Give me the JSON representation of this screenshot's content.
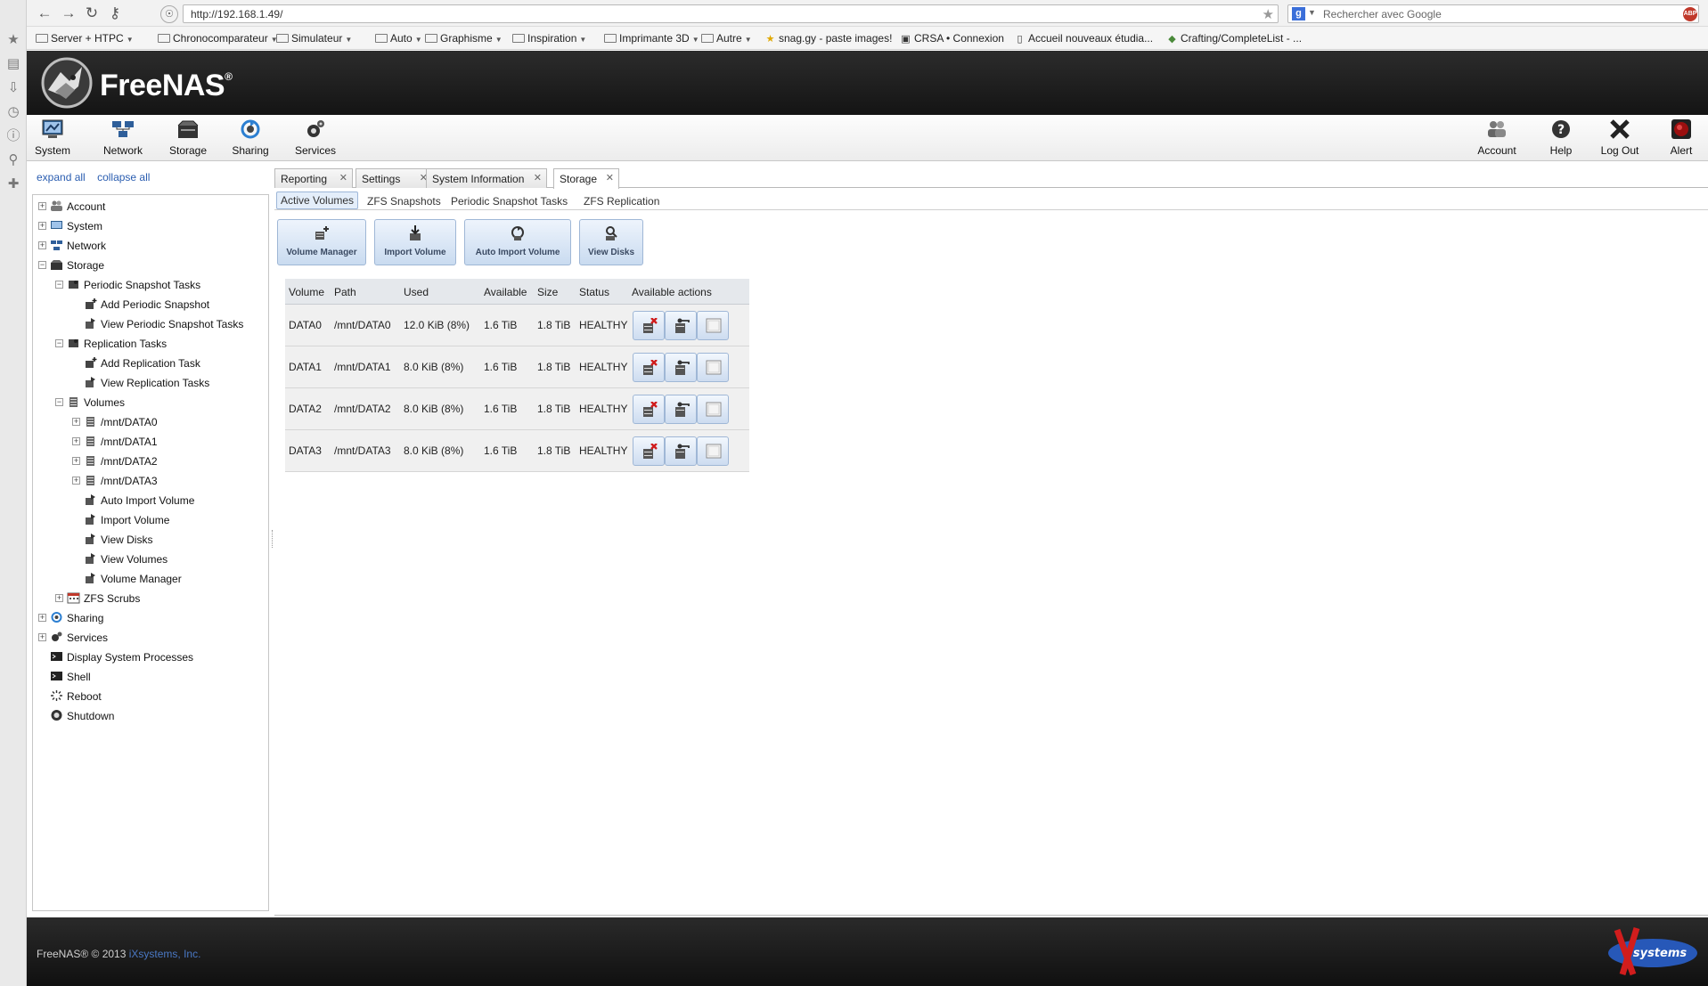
{
  "browser": {
    "url": "http://192.168.1.49/",
    "search_placeholder": "Rechercher avec Google",
    "abp_label": "ABP",
    "bookmarks": [
      {
        "label": "Server + HTPC",
        "folder": true,
        "caret": true
      },
      {
        "label": "Chronocomparateur",
        "folder": true,
        "caret": true
      },
      {
        "label": "Simulateur",
        "folder": true,
        "caret": true
      },
      {
        "label": "Auto",
        "folder": true,
        "caret": true
      },
      {
        "label": "Graphisme",
        "folder": true,
        "caret": true
      },
      {
        "label": "Inspiration",
        "folder": true,
        "caret": true
      },
      {
        "label": "Imprimante 3D",
        "folder": true,
        "caret": true
      },
      {
        "label": "Autre",
        "folder": true,
        "caret": true
      },
      {
        "label": "snag.gy - paste images!",
        "icon": "star-icon"
      },
      {
        "label": "CRSA • Connexion",
        "icon": "crsa-icon"
      },
      {
        "label": "Accueil nouveaux étudia...",
        "icon": "doc-icon"
      },
      {
        "label": "Crafting/CompleteList - ...",
        "icon": "cube-icon"
      }
    ]
  },
  "app": {
    "logo_text": "FreeNAS",
    "logo_mark": "®",
    "nav_left": [
      {
        "label": "System",
        "icon": "system-icon"
      },
      {
        "label": "Network",
        "icon": "network-icon"
      },
      {
        "label": "Storage",
        "icon": "storage-icon"
      },
      {
        "label": "Sharing",
        "icon": "sharing-icon"
      },
      {
        "label": "Services",
        "icon": "services-icon"
      }
    ],
    "nav_right": [
      {
        "label": "Account",
        "icon": "account-icon"
      },
      {
        "label": "Help",
        "icon": "help-icon"
      },
      {
        "label": "Log Out",
        "icon": "logout-icon"
      },
      {
        "label": "Alert",
        "icon": "alert-icon"
      }
    ]
  },
  "tree": {
    "expand_all": "expand all",
    "collapse_all": "collapse all",
    "items": [
      {
        "label": "Account",
        "level": 0,
        "expander": "+"
      },
      {
        "label": "System",
        "level": 0,
        "expander": "+"
      },
      {
        "label": "Network",
        "level": 0,
        "expander": "+"
      },
      {
        "label": "Storage",
        "level": 0,
        "expander": "−"
      },
      {
        "label": "Periodic Snapshot Tasks",
        "level": 1,
        "expander": "−"
      },
      {
        "label": "Add Periodic Snapshot",
        "level": 2,
        "expander": ""
      },
      {
        "label": "View Periodic Snapshot Tasks",
        "level": 2,
        "expander": ""
      },
      {
        "label": "Replication Tasks",
        "level": 1,
        "expander": "−"
      },
      {
        "label": "Add Replication Task",
        "level": 2,
        "expander": ""
      },
      {
        "label": "View Replication Tasks",
        "level": 2,
        "expander": ""
      },
      {
        "label": "Volumes",
        "level": 1,
        "expander": "−"
      },
      {
        "label": "/mnt/DATA0",
        "level": 2,
        "expander": "+"
      },
      {
        "label": "/mnt/DATA1",
        "level": 2,
        "expander": "+"
      },
      {
        "label": "/mnt/DATA2",
        "level": 2,
        "expander": "+"
      },
      {
        "label": "/mnt/DATA3",
        "level": 2,
        "expander": "+"
      },
      {
        "label": "Auto Import Volume",
        "level": 2,
        "expander": ""
      },
      {
        "label": "Import Volume",
        "level": 2,
        "expander": ""
      },
      {
        "label": "View Disks",
        "level": 2,
        "expander": ""
      },
      {
        "label": "View Volumes",
        "level": 2,
        "expander": ""
      },
      {
        "label": "Volume Manager",
        "level": 2,
        "expander": ""
      },
      {
        "label": "ZFS Scrubs",
        "level": 1,
        "expander": "+"
      },
      {
        "label": "Sharing",
        "level": 0,
        "expander": "+"
      },
      {
        "label": "Services",
        "level": 0,
        "expander": "+"
      },
      {
        "label": "Display System Processes",
        "level": 0,
        "expander": ""
      },
      {
        "label": "Shell",
        "level": 0,
        "expander": ""
      },
      {
        "label": "Reboot",
        "level": 0,
        "expander": ""
      },
      {
        "label": "Shutdown",
        "level": 0,
        "expander": ""
      }
    ]
  },
  "tabs": [
    {
      "label": "Reporting",
      "active": false
    },
    {
      "label": "Settings",
      "active": false
    },
    {
      "label": "System Information",
      "active": false
    },
    {
      "label": "Storage",
      "active": true
    }
  ],
  "subtabs": [
    {
      "label": "Active Volumes",
      "active": true
    },
    {
      "label": "ZFS Snapshots",
      "active": false
    },
    {
      "label": "Periodic Snapshot Tasks",
      "active": false
    },
    {
      "label": "ZFS Replication",
      "active": false
    }
  ],
  "actions": [
    {
      "label": "Volume Manager"
    },
    {
      "label": "Import Volume"
    },
    {
      "label": "Auto Import Volume"
    },
    {
      "label": "View Disks"
    }
  ],
  "volumes": {
    "headers": [
      "Volume",
      "Path",
      "Used",
      "Available",
      "Size",
      "Status",
      "Available actions"
    ],
    "rows": [
      {
        "volume": "DATA0",
        "path": "/mnt/DATA0",
        "used": "12.0 KiB (8%)",
        "available": "1.6 TiB",
        "size": "1.8 TiB",
        "status": "HEALTHY"
      },
      {
        "volume": "DATA1",
        "path": "/mnt/DATA1",
        "used": "8.0 KiB (8%)",
        "available": "1.6 TiB",
        "size": "1.8 TiB",
        "status": "HEALTHY"
      },
      {
        "volume": "DATA2",
        "path": "/mnt/DATA2",
        "used": "8.0 KiB (8%)",
        "available": "1.6 TiB",
        "size": "1.8 TiB",
        "status": "HEALTHY"
      },
      {
        "volume": "DATA3",
        "path": "/mnt/DATA3",
        "used": "8.0 KiB (8%)",
        "available": "1.6 TiB",
        "size": "1.8 TiB",
        "status": "HEALTHY"
      }
    ]
  },
  "footer": {
    "copyright": "FreeNAS® © 2013",
    "company": "iXsystems, Inc.",
    "logo_text": "systems"
  },
  "colors": {
    "header_bg": "#1e1e1e",
    "link": "#2a5db0",
    "button_bg": "#c9dbf0",
    "delete_red": "#d01c1c"
  }
}
